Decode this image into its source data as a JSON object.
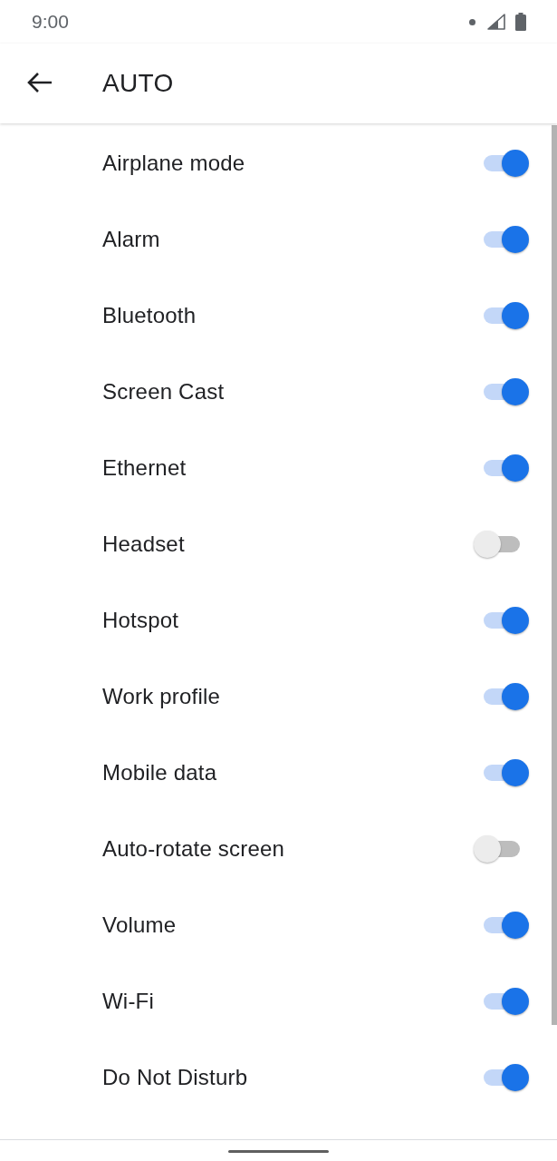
{
  "status_bar": {
    "time": "9:00"
  },
  "app_bar": {
    "title": "AUTO"
  },
  "items": [
    {
      "label": "Airplane mode",
      "checked": true
    },
    {
      "label": "Alarm",
      "checked": true
    },
    {
      "label": "Bluetooth",
      "checked": true
    },
    {
      "label": "Screen Cast",
      "checked": true
    },
    {
      "label": "Ethernet",
      "checked": true
    },
    {
      "label": "Headset",
      "checked": false
    },
    {
      "label": "Hotspot",
      "checked": true
    },
    {
      "label": "Work profile",
      "checked": true
    },
    {
      "label": "Mobile data",
      "checked": true
    },
    {
      "label": "Auto-rotate screen",
      "checked": false
    },
    {
      "label": "Volume",
      "checked": true
    },
    {
      "label": "Wi-Fi",
      "checked": true
    },
    {
      "label": "Do Not Disturb",
      "checked": true
    }
  ]
}
